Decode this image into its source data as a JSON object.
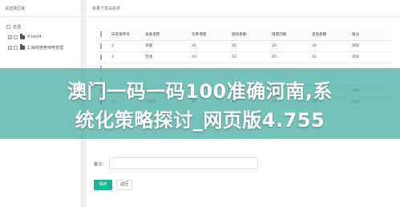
{
  "left_panel": {
    "title": "请选择区域",
    "select_all": "全选",
    "tree": [
      {
        "expander": "+",
        "label": "4:test4"
      },
      {
        "expander": "+",
        "label": "1:海校宿舍用电管理"
      }
    ]
  },
  "right_panel": {
    "title": "批量下发白名单",
    "columns": [
      "白名单序号",
      "设备名称",
      "功率增量",
      "波动系数",
      "增量因素",
      "波动系数",
      "备注"
    ],
    "rows": [
      [
        "2",
        "冰箱",
        "20",
        "20",
        "20",
        "20",
        "测试"
      ],
      [
        "3",
        "空调",
        "20",
        "20",
        "20",
        "20",
        "测试"
      ],
      [
        "",
        "",
        "",
        "",
        "",
        "",
        ""
      ],
      [
        "",
        "",
        "",
        "",
        "",
        "",
        ""
      ],
      [
        "",
        "热水器",
        "",
        "",
        "",
        "",
        "测试"
      ],
      [
        "25",
        "洗衣机",
        "20",
        "20",
        "20",
        "20",
        "测试"
      ]
    ],
    "note_label": "备注：",
    "note_value": "",
    "save_label": "保存",
    "back_label": "返回"
  },
  "banner": {
    "line1": "澳门一码一码100准确河南,系",
    "line2": "统化策略探讨_网页版4.755"
  },
  "colors": {
    "accent": "#1ab394",
    "banner": "#40aaa0"
  }
}
